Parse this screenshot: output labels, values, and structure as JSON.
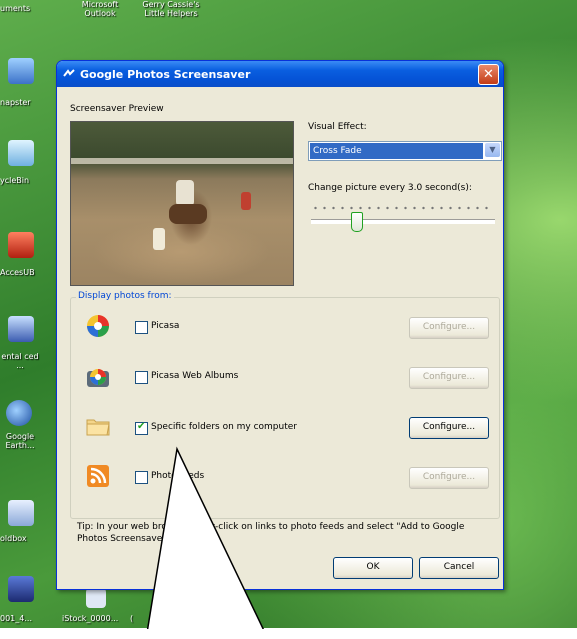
{
  "desktop": {
    "top_labels": [
      "uments",
      "Microsoft Outlook",
      "Gerry Cassie's Little Helpers"
    ],
    "left_labels": [
      "napster",
      "ycleBin",
      "AccesUB",
      "ental ced ...",
      "Google Earth...",
      "oldbox"
    ],
    "bottom_labels": [
      "001_4...",
      "iStock_0000...",
      "("
    ]
  },
  "window": {
    "title": "Google Photos Screensaver",
    "close_label": "✕",
    "preview_label": "Screensaver Preview",
    "visual_effect_label": "Visual Effect:",
    "visual_effect_value": "Cross Fade",
    "change_picture_label": "Change picture every 3.0 second(s):",
    "slider_fraction": 0.25,
    "display_from_label": "Display photos from:",
    "sources": [
      {
        "label": "Picasa",
        "checked": false,
        "configure": "Configure...",
        "enabled": false,
        "icon": "picasa-icon"
      },
      {
        "label": "Picasa Web Albums",
        "checked": false,
        "configure": "Configure...",
        "enabled": false,
        "icon": "picasa-web-albums-icon"
      },
      {
        "label": "Specific folders on my computer",
        "checked": true,
        "configure": "Configure...",
        "enabled": true,
        "icon": "folder-icon"
      },
      {
        "label": "Photo feeds",
        "checked": false,
        "configure": "Configure...",
        "enabled": false,
        "icon": "rss-feed-icon"
      }
    ],
    "tip": "Tip: In your web browser, right-click on links to photo feeds and select \"Add to Google Photos Screensaver\".",
    "ok_label": "OK",
    "cancel_label": "Cancel"
  },
  "colors": {
    "titlebar": "#0553d6",
    "selection": "#316ac5",
    "groupbox_title": "#0046d5"
  }
}
